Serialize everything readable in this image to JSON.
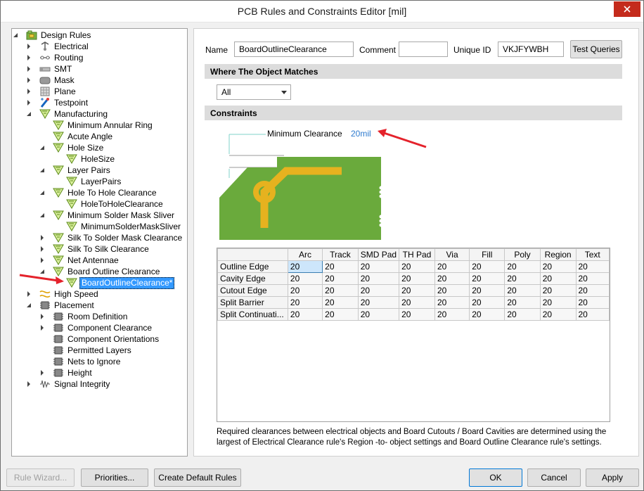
{
  "window": {
    "title": "PCB Rules and Constraints Editor [mil]"
  },
  "tree": {
    "items": [
      {
        "label": "Design Rules",
        "level": 0,
        "expander": "expanded",
        "icon": "design-rules-icon"
      },
      {
        "label": "Electrical",
        "level": 1,
        "expander": "collapsed",
        "icon": "electrical-icon"
      },
      {
        "label": "Routing",
        "level": 1,
        "expander": "collapsed",
        "icon": "routing-icon"
      },
      {
        "label": "SMT",
        "level": 1,
        "expander": "collapsed",
        "icon": "smt-icon"
      },
      {
        "label": "Mask",
        "level": 1,
        "expander": "collapsed",
        "icon": "mask-icon"
      },
      {
        "label": "Plane",
        "level": 1,
        "expander": "collapsed",
        "icon": "plane-icon"
      },
      {
        "label": "Testpoint",
        "level": 1,
        "expander": "collapsed",
        "icon": "testpoint-icon"
      },
      {
        "label": "Manufacturing",
        "level": 1,
        "expander": "expanded",
        "icon": "rule-icon"
      },
      {
        "label": "Minimum Annular Ring",
        "level": 2,
        "expander": "none",
        "icon": "rule-icon"
      },
      {
        "label": "Acute Angle",
        "level": 2,
        "expander": "none",
        "icon": "rule-icon"
      },
      {
        "label": "Hole Size",
        "level": 2,
        "expander": "expanded",
        "icon": "rule-icon"
      },
      {
        "label": "HoleSize",
        "level": 3,
        "expander": "none",
        "icon": "rule-icon"
      },
      {
        "label": "Layer Pairs",
        "level": 2,
        "expander": "expanded",
        "icon": "rule-icon"
      },
      {
        "label": "LayerPairs",
        "level": 3,
        "expander": "none",
        "icon": "rule-icon"
      },
      {
        "label": "Hole To Hole Clearance",
        "level": 2,
        "expander": "expanded",
        "icon": "rule-icon"
      },
      {
        "label": "HoleToHoleClearance",
        "level": 3,
        "expander": "none",
        "icon": "rule-icon"
      },
      {
        "label": "Minimum Solder Mask Sliver",
        "level": 2,
        "expander": "expanded",
        "icon": "rule-icon"
      },
      {
        "label": "MinimumSolderMaskSliver",
        "level": 3,
        "expander": "none",
        "icon": "rule-icon"
      },
      {
        "label": "Silk To Solder Mask Clearance",
        "level": 2,
        "expander": "collapsed",
        "icon": "rule-icon"
      },
      {
        "label": "Silk To Silk Clearance",
        "level": 2,
        "expander": "collapsed",
        "icon": "rule-icon"
      },
      {
        "label": "Net Antennae",
        "level": 2,
        "expander": "collapsed",
        "icon": "rule-icon"
      },
      {
        "label": "Board Outline Clearance",
        "level": 2,
        "expander": "expanded",
        "icon": "rule-icon"
      },
      {
        "label": "BoardOutlineClearance*",
        "level": 3,
        "expander": "none",
        "icon": "rule-icon",
        "selected": true
      },
      {
        "label": "High Speed",
        "level": 1,
        "expander": "collapsed",
        "icon": "high-speed-icon"
      },
      {
        "label": "Placement",
        "level": 1,
        "expander": "expanded",
        "icon": "placement-icon"
      },
      {
        "label": "Room Definition",
        "level": 2,
        "expander": "collapsed",
        "icon": "placement-icon"
      },
      {
        "label": "Component Clearance",
        "level": 2,
        "expander": "collapsed",
        "icon": "placement-icon"
      },
      {
        "label": "Component Orientations",
        "level": 2,
        "expander": "none",
        "icon": "placement-icon"
      },
      {
        "label": "Permitted Layers",
        "level": 2,
        "expander": "none",
        "icon": "placement-icon"
      },
      {
        "label": "Nets to Ignore",
        "level": 2,
        "expander": "none",
        "icon": "placement-icon"
      },
      {
        "label": "Height",
        "level": 2,
        "expander": "collapsed",
        "icon": "placement-icon"
      },
      {
        "label": "Signal Integrity",
        "level": 1,
        "expander": "collapsed",
        "icon": "signal-integrity-icon"
      }
    ]
  },
  "rule": {
    "name_label": "Name",
    "name_value": "BoardOutlineClearance",
    "comment_label": "Comment",
    "comment_value": "",
    "uid_label": "Unique ID",
    "uid_value": "VKJFYWBH",
    "test_queries_label": "Test Queries"
  },
  "where": {
    "header": "Where The Object Matches",
    "selected": "All"
  },
  "constraints": {
    "header": "Constraints",
    "min_clearance_label": "Minimum Clearance",
    "min_clearance_value": "20mil",
    "columns": [
      "Arc",
      "Track",
      "SMD Pad",
      "TH Pad",
      "Via",
      "Fill",
      "Poly",
      "Region",
      "Text"
    ],
    "rows": [
      {
        "name": "Outline Edge",
        "values": [
          "20",
          "20",
          "20",
          "20",
          "20",
          "20",
          "20",
          "20",
          "20"
        ]
      },
      {
        "name": "Cavity Edge",
        "values": [
          "20",
          "20",
          "20",
          "20",
          "20",
          "20",
          "20",
          "20",
          "20"
        ]
      },
      {
        "name": "Cutout Edge",
        "values": [
          "20",
          "20",
          "20",
          "20",
          "20",
          "20",
          "20",
          "20",
          "20"
        ]
      },
      {
        "name": "Split Barrier",
        "values": [
          "20",
          "20",
          "20",
          "20",
          "20",
          "20",
          "20",
          "20",
          "20"
        ]
      },
      {
        "name": "Split Continuati...",
        "values": [
          "20",
          "20",
          "20",
          "20",
          "20",
          "20",
          "20",
          "20",
          "20"
        ]
      }
    ],
    "description": "Required clearances between electrical objects and Board Cutouts / Board Cavities are determined using the largest of Electrical Clearance rule's Region -to- object settings and Board Outline Clearance rule's settings."
  },
  "footer": {
    "rule_wizard": "Rule Wizard...",
    "priorities": "Priorities...",
    "create_default": "Create Default Rules",
    "ok": "OK",
    "cancel": "Cancel",
    "apply": "Apply"
  },
  "colors": {
    "accent_red": "#e4222b",
    "board_green": "#6aaa3c",
    "trace_yellow": "#e6b21f",
    "selection_blue": "#3399ff",
    "link_blue": "#2e7bcf"
  }
}
